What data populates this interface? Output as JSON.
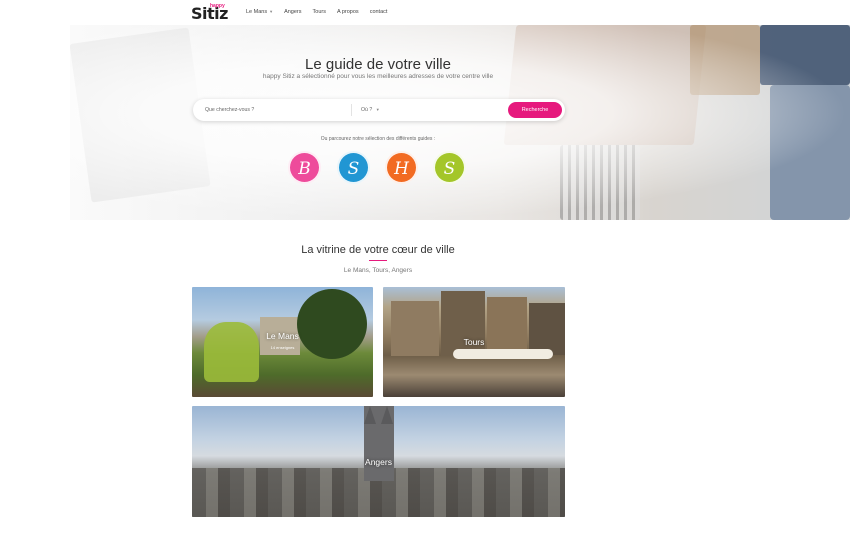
{
  "nav": {
    "logo": "Sitiz",
    "logo_sup": "happy",
    "links": [
      "Le Mans",
      "Angers",
      "Tours",
      "A propos",
      "contact"
    ]
  },
  "hero": {
    "title": "Le guide de votre ville",
    "subtitle": "happy Sitiz a sélectionné pour vous les meilleures adresses de votre centre ville",
    "search": {
      "what_placeholder": "Que cherchez-vous ?",
      "where_placeholder": "Où ?",
      "button_label": "Recherche"
    },
    "guides_label": "Ou parcourez notre sélection des différents guides :",
    "guides": [
      {
        "letter": "B",
        "color": "#ee4b9b"
      },
      {
        "letter": "S",
        "color": "#2196d3"
      },
      {
        "letter": "H",
        "color": "#f26b22"
      },
      {
        "letter": "S",
        "color": "#a4c629"
      }
    ]
  },
  "section": {
    "title": "La vitrine de votre cœur de ville",
    "subtitle": "Le Mans, Tours, Angers",
    "cities": [
      {
        "name": "Le Mans",
        "sublabel": "14 enseignes"
      },
      {
        "name": "Tours"
      },
      {
        "name": "Angers"
      }
    ]
  },
  "colors": {
    "accent": "#e6197d"
  }
}
